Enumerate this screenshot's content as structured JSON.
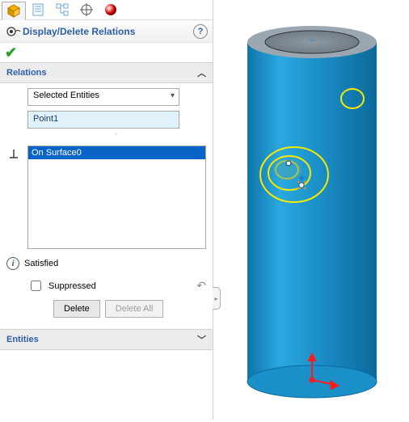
{
  "title": "Display/Delete Relations",
  "sections": {
    "relations": {
      "label": "Relations"
    },
    "entities": {
      "label": "Entities"
    }
  },
  "filter": {
    "mode": "Selected Entities",
    "entity": "Point1"
  },
  "relations_list": [
    "On Surface0"
  ],
  "status": {
    "text": "Satisfied"
  },
  "suppressed": {
    "label": "Suppressed",
    "checked": false
  },
  "buttons": {
    "delete": "Delete",
    "delete_all": "Delete All"
  },
  "tabs": {
    "active_icon": "cube-icon"
  }
}
